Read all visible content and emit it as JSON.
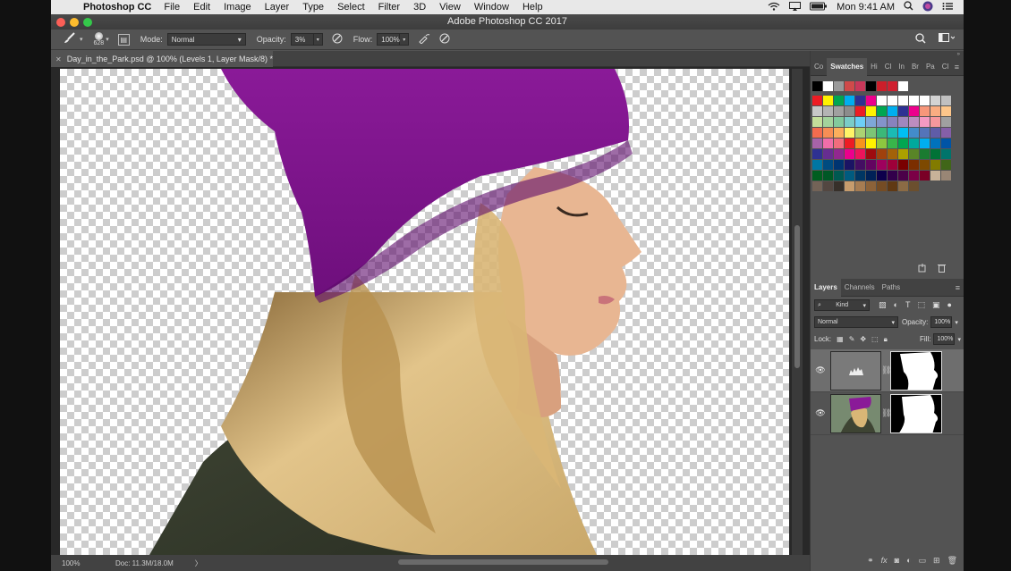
{
  "menubar": {
    "app_name": "Photoshop CC",
    "items": [
      "File",
      "Edit",
      "Image",
      "Layer",
      "Type",
      "Select",
      "Filter",
      "3D",
      "View",
      "Window",
      "Help"
    ],
    "clock": "Mon 9:41 AM"
  },
  "window": {
    "title": "Adobe Photoshop CC 2017"
  },
  "options": {
    "brush_size": "628",
    "mode_label": "Mode:",
    "mode_value": "Normal",
    "opacity_label": "Opacity:",
    "opacity_value": "3%",
    "flow_label": "Flow:",
    "flow_value": "100%"
  },
  "document": {
    "tab_title": "Day_in_the_Park.psd @ 100% (Levels 1, Layer Mask/8) *"
  },
  "status": {
    "zoom": "100%",
    "doc_info": "Doc: 11.3M/18.0M",
    "arrow": "〉"
  },
  "swatches_panel": {
    "tabs": [
      "Co",
      "Swatches",
      "Hi",
      "Cl",
      "In",
      "Br",
      "Pa",
      "Cl"
    ],
    "recent": [
      "#000000",
      "#ffffff",
      "#9a9a9a",
      "#d04a4a",
      "#c8385a",
      "#000000",
      "#cc1e2a",
      "#d02030",
      "#ffffff"
    ],
    "colors": [
      "#ed1c24",
      "#fff200",
      "#00a651",
      "#00aeef",
      "#2e3192",
      "#ec008c",
      "#ffffff",
      "#ffffff",
      "#ffffff",
      "#ffffff",
      "#ffffff",
      "#d3d3d3",
      "#c0c0c0",
      "#c8c8c8",
      "#b4b4b4",
      "#a0a0a0",
      "#8c8c8c",
      "#ed1c24",
      "#fff200",
      "#00a651",
      "#00aeef",
      "#2e3192",
      "#ec008c",
      "#f7977a",
      "#f9ad81",
      "#fdc68a",
      "#c4df9b",
      "#a3d39c",
      "#82ca9d",
      "#7accc8",
      "#6dcff6",
      "#7ea7d8",
      "#8493ca",
      "#8882be",
      "#a187be",
      "#bc8dbf",
      "#f49ac2",
      "#f6989d",
      "#a0a0a0",
      "#f26c4f",
      "#f68e55",
      "#fbaf5c",
      "#fff467",
      "#acd372",
      "#7cc576",
      "#3bb878",
      "#1abbb4",
      "#00bff3",
      "#438cca",
      "#5574b9",
      "#605ca8",
      "#855fa8",
      "#a763a8",
      "#f06ea9",
      "#f26d7d",
      "#ed1c24",
      "#f7941d",
      "#fff200",
      "#8dc63f",
      "#39b54a",
      "#00a651",
      "#00a99d",
      "#00aeef",
      "#0072bc",
      "#0054a6",
      "#2e3192",
      "#662d91",
      "#92278f",
      "#ec008c",
      "#ed145b",
      "#9e0b0f",
      "#a0410d",
      "#a36209",
      "#aba000",
      "#598527",
      "#1a7b30",
      "#007236",
      "#00746b",
      "#0076a3",
      "#004b80",
      "#003471",
      "#1b1464",
      "#440e62",
      "#630460",
      "#9e005d",
      "#9e0039",
      "#790000",
      "#7b2e00",
      "#7d4900",
      "#827b00",
      "#406618",
      "#005e20",
      "#005826",
      "#005952",
      "#005b7f",
      "#003663",
      "#002157",
      "#0d004c",
      "#32004b",
      "#4b0049",
      "#7b0046",
      "#7a0026",
      "#c7b299",
      "#998675",
      "#736357",
      "#534741",
      "#37302a",
      "#c69c6d",
      "#a67c52",
      "#8c6239",
      "#754c24",
      "#603913",
      "#8b6b45",
      "#6b4f2e"
    ]
  },
  "layers_panel": {
    "tabs": [
      "Layers",
      "Channels",
      "Paths"
    ],
    "filter_label": "Kind",
    "blend_mode": "Normal",
    "opacity_label": "Opacity:",
    "opacity_value": "100%",
    "lock_label": "Lock:",
    "fill_label": "Fill:",
    "fill_value": "100%"
  }
}
